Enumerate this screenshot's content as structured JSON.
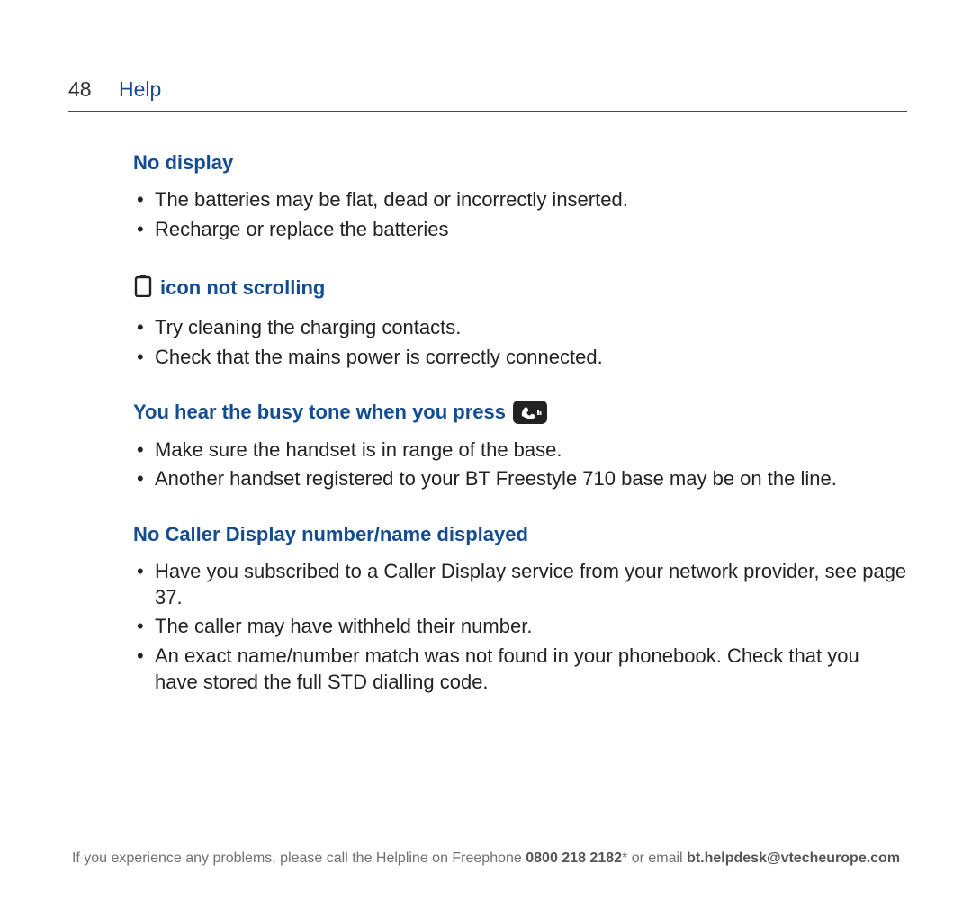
{
  "header": {
    "page_number": "48",
    "title": "Help"
  },
  "sections": {
    "no_display": {
      "heading": "No display",
      "items": [
        "The batteries may be flat, dead or incorrectly inserted.",
        "Recharge or replace the batteries"
      ]
    },
    "icon_not_scrolling": {
      "heading": "icon not scrolling",
      "items": [
        "Try cleaning the charging contacts.",
        "Check that the mains power is correctly connected."
      ]
    },
    "busy_tone": {
      "heading": "You hear the busy tone when you press",
      "items": [
        "Make sure the handset is in range of the base.",
        "Another handset registered to your BT Freestyle 710 base may be on the line."
      ]
    },
    "no_caller_display": {
      "heading": "No Caller Display number/name displayed",
      "items": [
        "Have you subscribed to a Caller Display service from your network provider, see page 37.",
        "The caller may have withheld their number.",
        "An exact name/number match was not found in your phonebook. Check that you have stored the full STD dialling code."
      ]
    }
  },
  "footer": {
    "prefix": "If you experience any problems, please call the Helpline on Freephone ",
    "phone": "0800 218 2182",
    "mid": "* or email ",
    "email": "bt.helpdesk@vtecheurope.com"
  }
}
